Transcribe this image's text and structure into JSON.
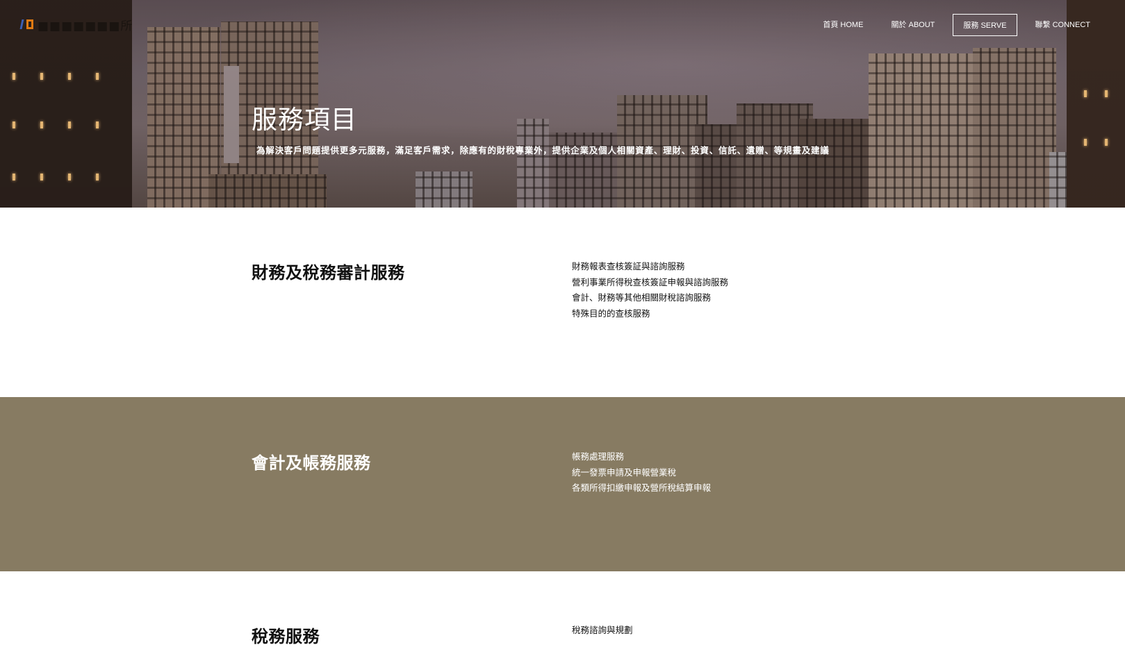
{
  "logo": {
    "text": "■■■■■■■所"
  },
  "nav": {
    "items": [
      {
        "label": "首頁 HOME",
        "active": false
      },
      {
        "label": "關於 ABOUT",
        "active": false
      },
      {
        "label": "服務 SERVE",
        "active": true
      },
      {
        "label": "聯繫 CONNECT",
        "active": false
      }
    ]
  },
  "hero": {
    "title": "服務項目",
    "subtitle": "為解決客戶問題提供更多元服務，滿足客戶需求，除應有的財稅專業外，提供企業及個人相關資產、理財、投資、信託、遺贈、等規畫及建議"
  },
  "sections": [
    {
      "title": "財務及稅務審計服務",
      "items": [
        "財務報表查核簽証與諮詢服務",
        "營利事業所得稅查核簽証申報與諮詢服務",
        "會計、財務等其他相關財稅諮詢服務",
        "特殊目的的查核服務"
      ]
    },
    {
      "title": "會計及帳務服務",
      "items": [
        "帳務處理服務",
        "統一發票申請及申報營業稅",
        "各類所得扣繳申報及營所稅結算申報"
      ]
    },
    {
      "title": "稅務服務",
      "items": [
        "稅務諮詢與規劃"
      ]
    }
  ]
}
